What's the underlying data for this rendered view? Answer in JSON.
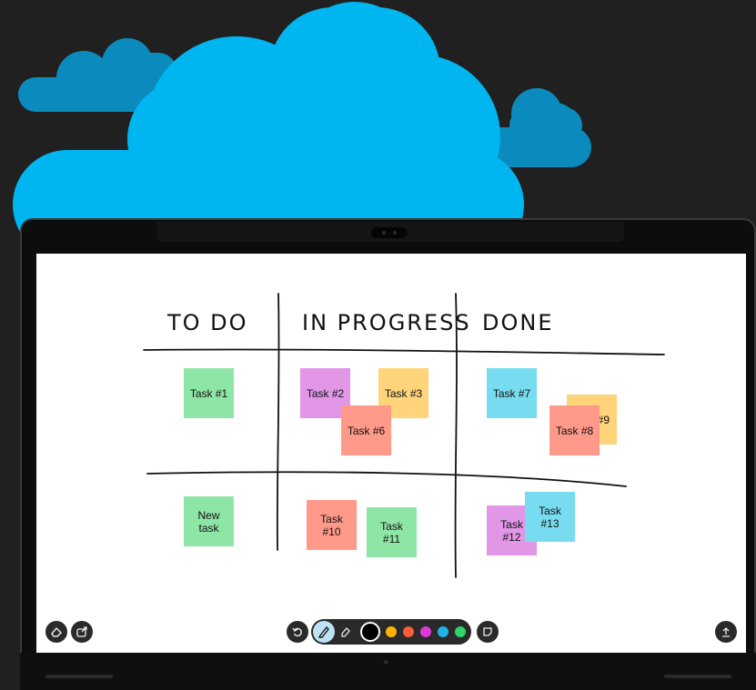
{
  "board": {
    "columns": [
      {
        "heading": "TO DO"
      },
      {
        "heading": "IN PROGRESS"
      },
      {
        "heading": "DONE"
      }
    ],
    "notes": [
      {
        "id": "task-1",
        "text": "Task #1",
        "color": "#8ee6a6"
      },
      {
        "id": "task-2",
        "text": "Task #2",
        "color": "#e196e6"
      },
      {
        "id": "task-3",
        "text": "Task #3",
        "color": "#ffd47a"
      },
      {
        "id": "task-6",
        "text": "Task #6",
        "color": "#ff9a8a"
      },
      {
        "id": "task-7",
        "text": "Task #7",
        "color": "#78dcf0"
      },
      {
        "id": "task-9",
        "text": "#9",
        "color": "#ffd47a"
      },
      {
        "id": "task-8",
        "text": "Task #8",
        "color": "#ff9a8a"
      },
      {
        "id": "new-task",
        "text": "New\ntask",
        "color": "#8ee6a6"
      },
      {
        "id": "task-10",
        "text": "Task\n#10",
        "color": "#ff9a8a"
      },
      {
        "id": "task-11",
        "text": "Task\n#11",
        "color": "#8ee6a6"
      },
      {
        "id": "task-12",
        "text": "Task\n#12",
        "color": "#e196e6"
      },
      {
        "id": "task-13",
        "text": "Task\n#13",
        "color": "#78dcf0"
      }
    ]
  },
  "toolbar": {
    "left_buttons": [
      {
        "name": "erase-board-icon"
      },
      {
        "name": "share-out-icon"
      }
    ],
    "undo_icon": "undo-icon",
    "pen_icon": "pen-icon",
    "eraser_icon": "eraser-icon",
    "pen_colors": [
      "#000000",
      "#ffb300",
      "#ff5a3c",
      "#e03ad6",
      "#1fb4e6",
      "#2ed36a"
    ],
    "selected_color": "#000000",
    "sticky_note_icon": "sticky-note-icon",
    "upload_icon": "upload-icon"
  },
  "colors": {
    "cloud_main": "#00b6f1",
    "cloud_back": "#0b8bbd",
    "background": "#202020"
  }
}
